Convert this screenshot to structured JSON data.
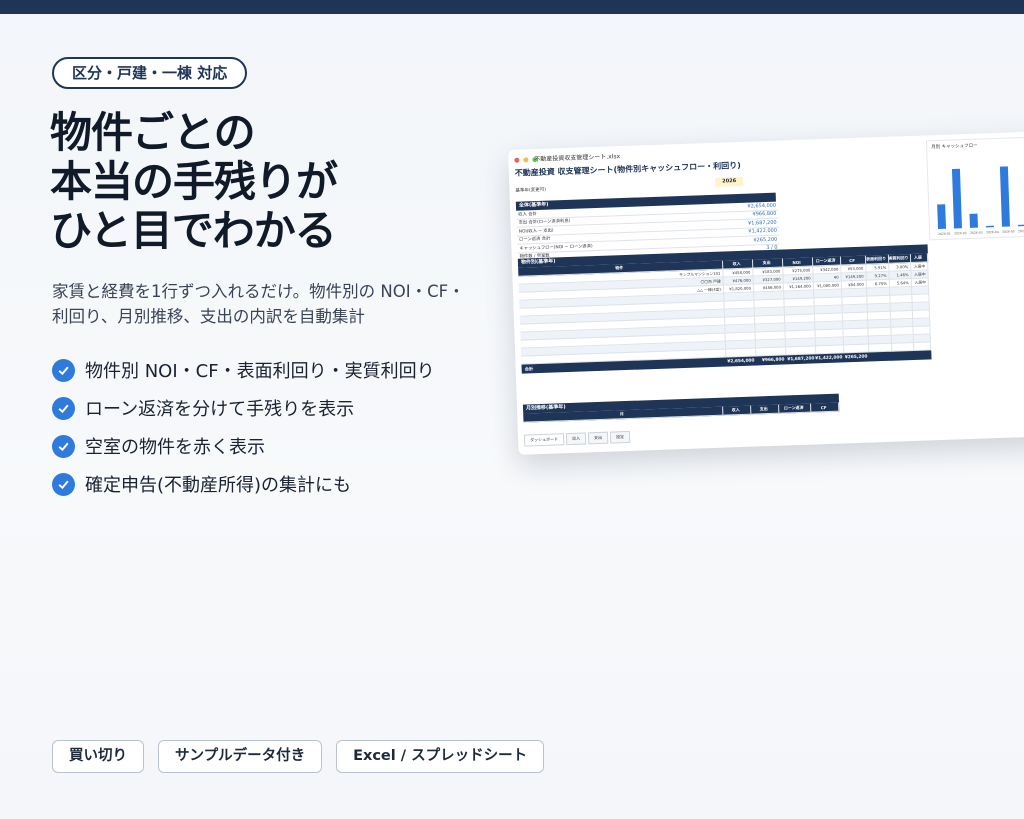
{
  "badge": "区分・戸建・一棟 対応",
  "headline": [
    "物件ごとの",
    "本当の手残りが",
    "ひと目でわかる"
  ],
  "sub": [
    "家賃と経費を1行ずつ入れるだけ。物件別の NOI・CF・",
    "利回り、月別推移、支出の内訳を自動集計"
  ],
  "features": [
    "物件別 NOI・CF・表面利回り・実質利回り",
    "ローン返済を分けて手残りを表示",
    "空室の物件を赤く表示",
    "確定申告(不動産所得)の集計にも"
  ],
  "tags": [
    "買い切り",
    "サンプルデータ付き",
    "Excel / スプレッドシート"
  ],
  "colors": {
    "navy": "#1e3558",
    "accent": "#2f7bdd"
  },
  "sheet": {
    "filename": "不動産投資収支管理シート.xlsx",
    "title": "不動産投資 収支管理シート(物件別キャッシュフロー・利回り)",
    "year_label": "基準年(変更可)",
    "year": "2026",
    "summary_title": "全体(基準年)",
    "summary_rows": [
      {
        "label": "収入 合計",
        "value": "¥2,654,000"
      },
      {
        "label": "支出 合計(ローン返済利息)",
        "value": "¥966,800"
      },
      {
        "label": "NOI(収入 − 支出)",
        "value": "¥1,687,200"
      },
      {
        "label": "ローン返済 合計",
        "value": "¥1,422,000"
      },
      {
        "label": "キャッシュフロー(NOI − ローン返済)",
        "value": "¥265,200"
      },
      {
        "label": "物件数 / 空室数",
        "value": "3 / 0"
      }
    ],
    "table_title": "物件別(基準年)",
    "table_headers": [
      "物件",
      "収入",
      "支出",
      "NOI",
      "ローン返済",
      "CF",
      "表面利回り",
      "実質利回り",
      "入居"
    ],
    "table_rows": [
      [
        "サンプルマンション101",
        "¥458,000",
        "¥183,000",
        "¥275,000",
        "¥342,000",
        "¥53,000",
        "5.91%",
        "3.00%",
        "入居中"
      ],
      [
        "〇〇市 戸建",
        "¥476,000",
        "¥327,000",
        "¥149,200",
        "¥0",
        "¥149,200",
        "9.27%",
        "1.46%",
        "入居中"
      ],
      [
        "△△ 一棟(4室)",
        "¥1,820,000",
        "¥456,000",
        "¥1,164,000",
        "¥1,080,000",
        "¥84,000",
        "6.75%",
        "5.64%",
        "入居中"
      ]
    ],
    "total_label": "合計",
    "totals": [
      "¥2,654,000",
      "¥966,800",
      "¥1,687,200",
      "¥1,422,000",
      "¥265,200"
    ],
    "monthly_title": "月別推移(基準年)",
    "monthly_headers": [
      "月",
      "収入",
      "支出",
      "ローン返済",
      "CF"
    ],
    "chart_title": "月別 キャッシュフロー",
    "chart_bars": [
      0.35,
      0.85,
      0.2,
      0.02,
      0.86,
      0.02
    ],
    "chart_labels": [
      "2026-01",
      "2026-02",
      "2026-03",
      "2026-04",
      "2026-05",
      "2026-06"
    ],
    "tabs": [
      "ダッシュボード",
      "収入",
      "支出",
      "設定"
    ]
  }
}
